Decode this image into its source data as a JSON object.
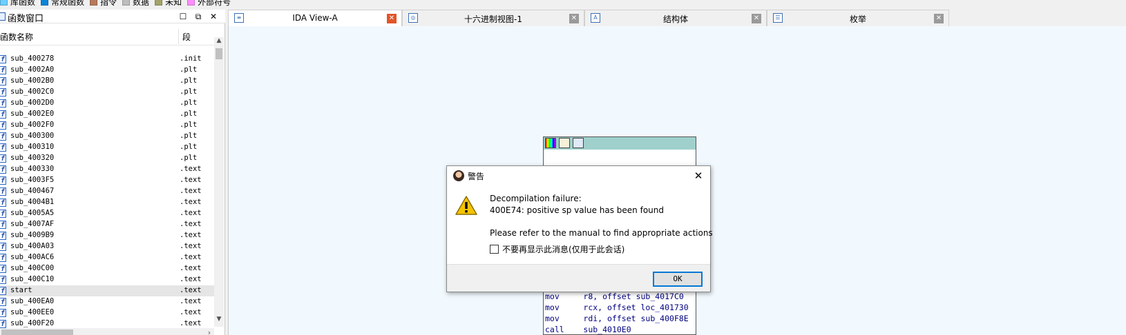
{
  "legend": [
    {
      "label": "库函数",
      "color": "#6ccfff"
    },
    {
      "label": "常规函数",
      "color": "#0a84d8"
    },
    {
      "label": "指令",
      "color": "#b87a5c"
    },
    {
      "label": "数据",
      "color": "#bdbdbd"
    },
    {
      "label": "未知",
      "color": "#a3a36a"
    },
    {
      "label": "外部符号",
      "color": "#ff8dff"
    }
  ],
  "functions_window": {
    "title": "函数窗口",
    "column_name": "函数名称",
    "column_segment": "段",
    "rows": [
      {
        "name": "sub_400278",
        "segment": ".init"
      },
      {
        "name": "sub_4002A0",
        "segment": ".plt"
      },
      {
        "name": "sub_4002B0",
        "segment": ".plt"
      },
      {
        "name": "sub_4002C0",
        "segment": ".plt"
      },
      {
        "name": "sub_4002D0",
        "segment": ".plt"
      },
      {
        "name": "sub_4002E0",
        "segment": ".plt"
      },
      {
        "name": "sub_4002F0",
        "segment": ".plt"
      },
      {
        "name": "sub_400300",
        "segment": ".plt"
      },
      {
        "name": "sub_400310",
        "segment": ".plt"
      },
      {
        "name": "sub_400320",
        "segment": ".plt"
      },
      {
        "name": "sub_400330",
        "segment": ".text"
      },
      {
        "name": "sub_4003F5",
        "segment": ".text"
      },
      {
        "name": "sub_400467",
        "segment": ".text"
      },
      {
        "name": "sub_4004B1",
        "segment": ".text"
      },
      {
        "name": "sub_4005A5",
        "segment": ".text"
      },
      {
        "name": "sub_4007AF",
        "segment": ".text"
      },
      {
        "name": "sub_4009B9",
        "segment": ".text"
      },
      {
        "name": "sub_400A03",
        "segment": ".text"
      },
      {
        "name": "sub_400AC6",
        "segment": ".text"
      },
      {
        "name": "sub_400C00",
        "segment": ".text"
      },
      {
        "name": "sub_400C10",
        "segment": ".text"
      },
      {
        "name": "start",
        "segment": ".text"
      },
      {
        "name": "sub_400EA0",
        "segment": ".text"
      },
      {
        "name": "sub_400EE0",
        "segment": ".text"
      },
      {
        "name": "sub_400F20",
        "segment": ".text"
      }
    ]
  },
  "tabs": [
    {
      "label": "IDA View-A",
      "active": true
    },
    {
      "label": "十六进制视图-1",
      "active": false
    },
    {
      "label": "结构体",
      "active": false
    },
    {
      "label": "枚举",
      "active": false
    }
  ],
  "graph_node": {
    "lines": [
      {
        "op": "mov",
        "args": "r8, offset sub_4017C0"
      },
      {
        "op": "mov",
        "args": "rcx, offset loc_401730"
      },
      {
        "op": "mov",
        "args": "rdi, offset sub_400F8E"
      },
      {
        "op": "call",
        "args": "sub_4010E0"
      }
    ]
  },
  "dialog": {
    "title": "警告",
    "line1": "Decompilation failure:",
    "line2": "400E74: positive sp value has been found",
    "line3": "Please refer to the manual to find appropriate actions",
    "checkbox_label": "不要再显示此消息(仅用于此会话)",
    "ok_label": "OK"
  }
}
